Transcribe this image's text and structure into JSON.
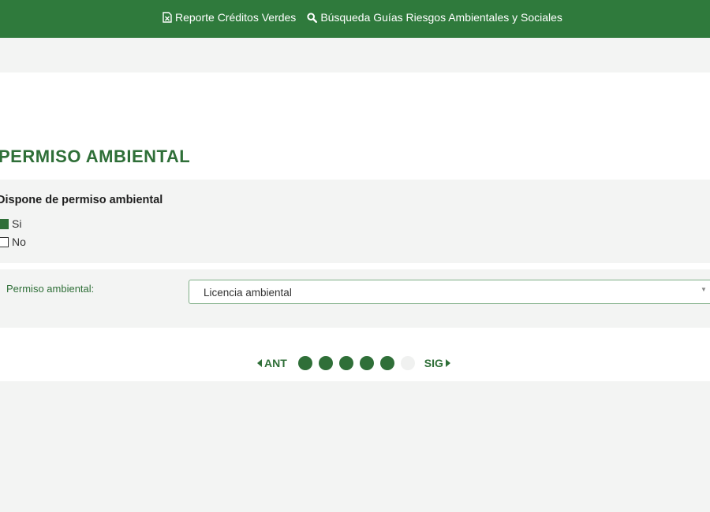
{
  "colors": {
    "brand_green": "#2f7a3c",
    "title_green": "#2f6f38",
    "background_gray": "#f3f4f3",
    "inactive_dot": "#f0f1f0"
  },
  "topnav": {
    "items": [
      {
        "label": "Reporte Créditos Verdes",
        "icon": "document-excel-icon"
      },
      {
        "label": "Búsqueda Guías Riesgos Ambientales y Sociales",
        "icon": "search-icon"
      }
    ]
  },
  "section": {
    "title": "PERMISO AMBIENTAL"
  },
  "question": {
    "label": "Dispone de permiso ambiental",
    "options": [
      {
        "label": "Si",
        "checked": true
      },
      {
        "label": "No",
        "checked": false
      }
    ]
  },
  "permit_field": {
    "label": "Permiso ambiental:",
    "selected": "Licencia ambiental"
  },
  "pager": {
    "prev_label": "ANT",
    "next_label": "SIG",
    "total_steps": 6,
    "completed_steps": 5
  }
}
